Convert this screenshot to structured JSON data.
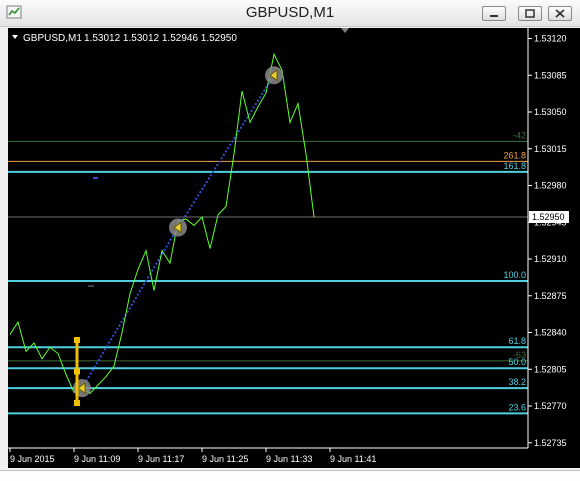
{
  "window": {
    "title": "GBPUSD,M1",
    "buttons": [
      {
        "name": "minimize",
        "icon": "minimize-icon"
      },
      {
        "name": "restore",
        "icon": "restore-icon"
      },
      {
        "name": "close",
        "icon": "close-icon"
      }
    ]
  },
  "colors": {
    "background": "#000000",
    "price_line": "#5cff2a",
    "fib_levels": "#4fd0e0",
    "fib_extension": "#f0a050",
    "grid_level": "#3c6e3c",
    "trend_line": "#3050d0",
    "axis": "#ffffff",
    "current_price_box": "#ffffff"
  },
  "chart_header": {
    "symbol": "GBPUSD,M1",
    "ohlc": "1.53012 1.53012 1.52946 1.52950"
  },
  "chart_data": {
    "type": "line",
    "title": "",
    "x_ticks": [
      "9 Jun 2015",
      "9 Jun 11:09",
      "9 Jun 11:17",
      "9 Jun 11:25",
      "9 Jun 11:33",
      "9 Jun 11:41"
    ],
    "y_ticks": [
      "1.53120",
      "1.53085",
      "1.53050",
      "1.53015",
      "1.52980",
      "1.52945",
      "1.52910",
      "1.52875",
      "1.52840",
      "1.52805",
      "1.52770",
      "1.52735"
    ],
    "ylim": [
      1.5273,
      1.5313
    ],
    "series": [
      {
        "values": [
          1.52838,
          1.5285,
          1.52822,
          1.5283,
          1.52815,
          1.52826,
          1.5282,
          1.528,
          1.52783,
          1.52788,
          1.52782,
          1.5279,
          1.52798,
          1.52808,
          1.5284,
          1.52877,
          1.529,
          1.52918,
          1.5288,
          1.52918,
          1.52906,
          1.52946,
          1.52948,
          1.52942,
          1.5295,
          1.5292,
          1.52952,
          1.5296,
          1.5301,
          1.5307,
          1.5304,
          1.53055,
          1.53068,
          1.53105,
          1.5309,
          1.5304,
          1.53058,
          1.5301,
          1.5295
        ]
      }
    ],
    "current_price": "1.52950",
    "fib_levels": [
      {
        "label": "-42",
        "price": 1.53022,
        "kind": "grid"
      },
      {
        "label": "261.8",
        "price": 1.53003,
        "kind": "extension"
      },
      {
        "label": "161.8",
        "price": 1.52993,
        "kind": "fib"
      },
      {
        "label": "100.0",
        "price": 1.52889,
        "kind": "fib"
      },
      {
        "label": "61.8",
        "price": 1.52826,
        "kind": "fib"
      },
      {
        "label": "-63",
        "price": 1.52813,
        "kind": "grid"
      },
      {
        "label": "50.0",
        "price": 1.52806,
        "kind": "fib"
      },
      {
        "label": "38.2",
        "price": 1.52787,
        "kind": "fib"
      },
      {
        "label": "23.6",
        "price": 1.52763,
        "kind": "fib"
      }
    ],
    "trend_points": [
      {
        "index": 9,
        "price": 1.52787
      },
      {
        "index": 21,
        "price": 1.5294
      },
      {
        "index": 33,
        "price": 1.53085
      }
    ]
  }
}
